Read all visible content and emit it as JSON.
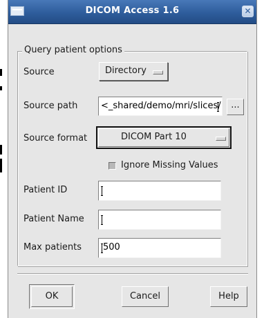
{
  "window": {
    "title": "DICOM Access 1.6"
  },
  "group": {
    "legend": "Query patient options"
  },
  "source": {
    "label": "Source",
    "value": "Directory"
  },
  "source_path": {
    "label": "Source path",
    "value": "<_shared/demo/mri/slices/",
    "browse_label": "..."
  },
  "source_format": {
    "label": "Source format",
    "value": "DICOM Part 10"
  },
  "ignore_missing": {
    "label": "Ignore Missing Values",
    "checked": false
  },
  "patient_id": {
    "label": "Patient ID",
    "value": ""
  },
  "patient_name": {
    "label": "Patient Name",
    "value": ""
  },
  "max_patients": {
    "label": "Max patients",
    "value": "500"
  },
  "buttons": {
    "ok": "OK",
    "cancel": "Cancel",
    "help": "Help"
  }
}
